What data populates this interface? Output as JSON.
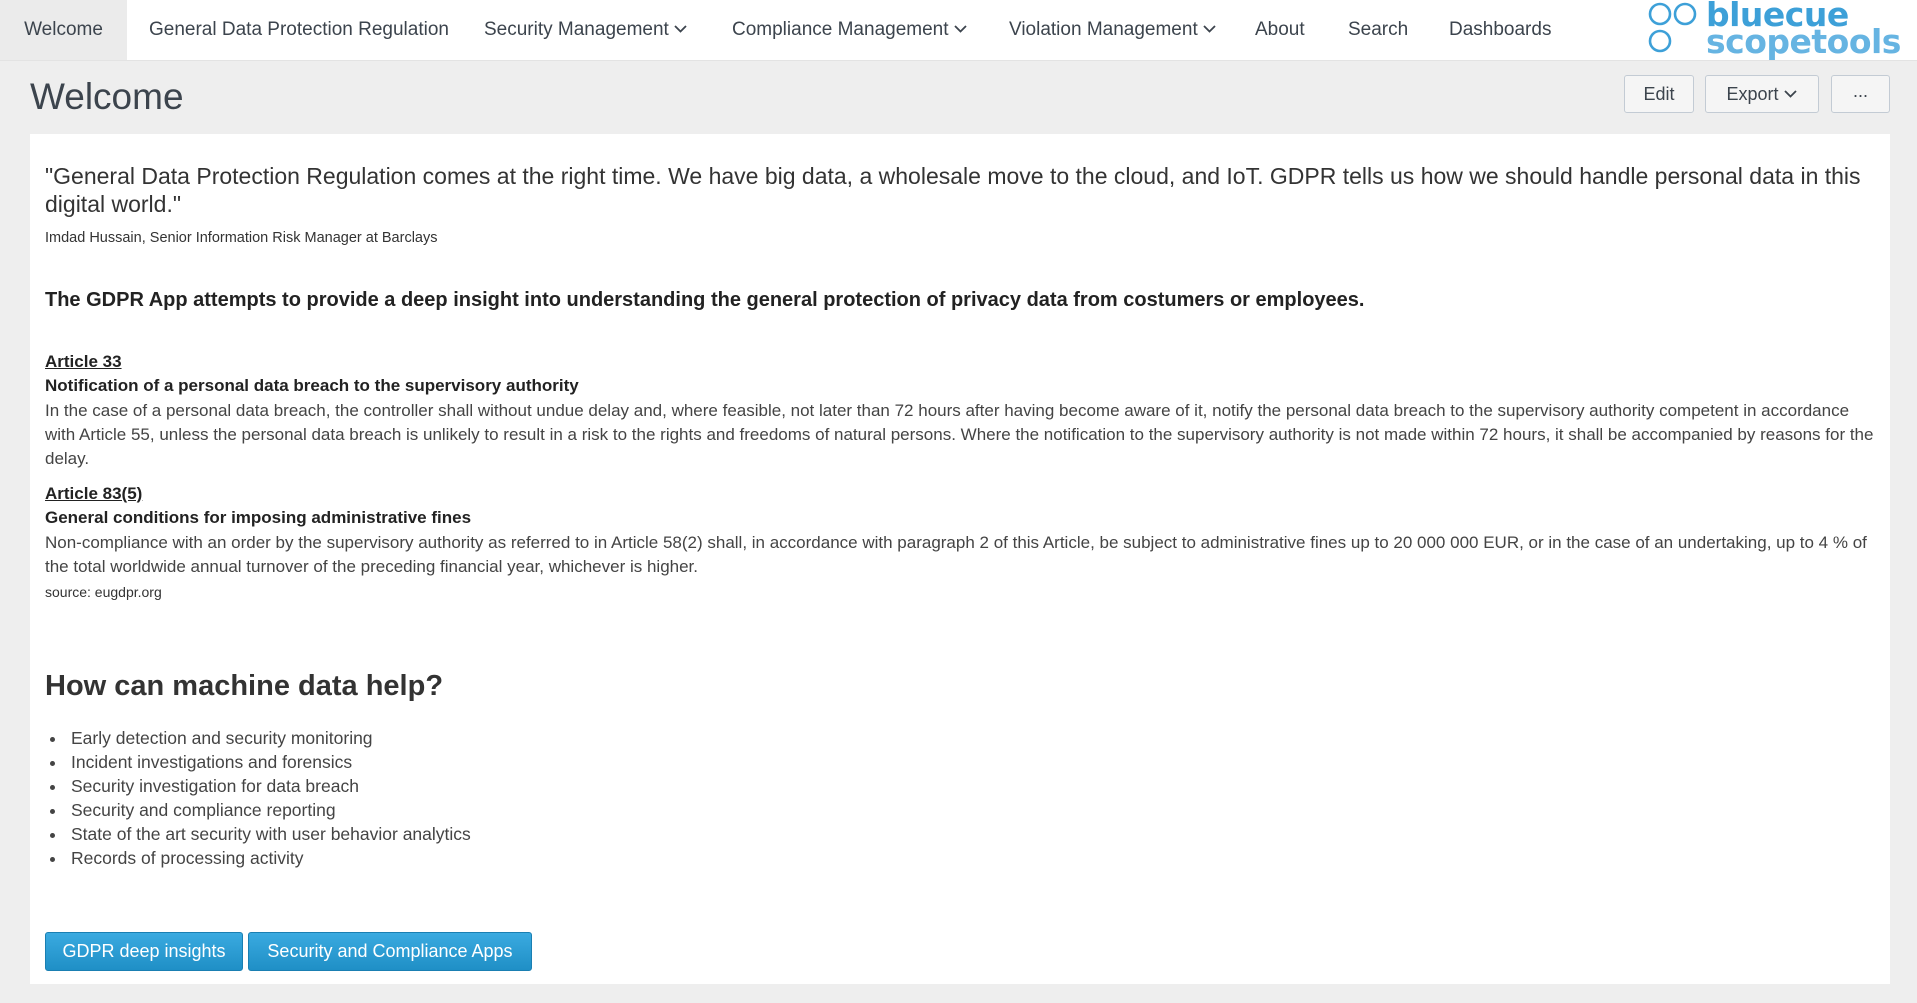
{
  "nav": {
    "items": [
      {
        "label": "Welcome",
        "dropdown": false
      },
      {
        "label": "General Data Protection Regulation",
        "dropdown": false
      },
      {
        "label": "Security Management",
        "dropdown": true
      },
      {
        "label": "Compliance Management",
        "dropdown": true
      },
      {
        "label": "Violation Management",
        "dropdown": true
      },
      {
        "label": "About",
        "dropdown": false
      },
      {
        "label": "Search",
        "dropdown": false
      },
      {
        "label": "Dashboards",
        "dropdown": false
      }
    ],
    "active": "Welcome"
  },
  "logo": {
    "line1": "bluecue",
    "line2": "scopetools"
  },
  "page": {
    "title": "Welcome",
    "edit_label": "Edit",
    "export_label": "Export",
    "more_label": "..."
  },
  "content": {
    "quote": "\"General Data Protection Regulation comes at the right time. We have big data, a wholesale move to the cloud, and IoT. GDPR tells us how we should handle personal data in this digital world.\"",
    "attribution": "Imdad Hussain, Senior Information Risk Manager at Barclays",
    "lead": "The GDPR App attempts to provide a deep insight into understanding the general protection of privacy data from costumers or employees.",
    "articles": [
      {
        "link": "Article 33",
        "title": "Notification of a personal data breach to the supervisory authority",
        "body": "In the case of a personal data breach, the controller shall without undue delay and, where feasible, not later than 72 hours after having become aware of it, notify the personal data breach to the supervisory authority competent in accordance with Article 55, unless the personal data breach is unlikely to result in a risk to the rights and freedoms of natural persons. Where the notification to the supervisory authority is not made within 72 hours, it shall be accompanied by reasons for the delay."
      },
      {
        "link": "Article 83(5)",
        "title": "General conditions for imposing administrative fines",
        "body": "Non-compliance with an order by the supervisory authority as referred to in Article 58(2) shall, in accordance with paragraph 2 of this Article, be subject to administrative fines up to 20 000 000 EUR, or in the case of an undertaking, up to 4 % of the total worldwide annual turnover of the preceding financial year, whichever is higher."
      }
    ],
    "source": "source: eugdpr.org",
    "section_heading": "How can machine data help?",
    "bullets": [
      "Early detection and security monitoring",
      "Incident investigations and forensics",
      "Security investigation for data breach",
      "Security and compliance reporting",
      "State of the art security with user behavior analytics",
      "Records of processing activity"
    ],
    "buttons": [
      "GDPR deep insights",
      "Security and Compliance Apps"
    ]
  },
  "colors": {
    "page_background": "#eeeeee",
    "panel_background": "#ffffff",
    "primary_button": "#2a9fd6",
    "logo_blue": "#3da0d8"
  }
}
